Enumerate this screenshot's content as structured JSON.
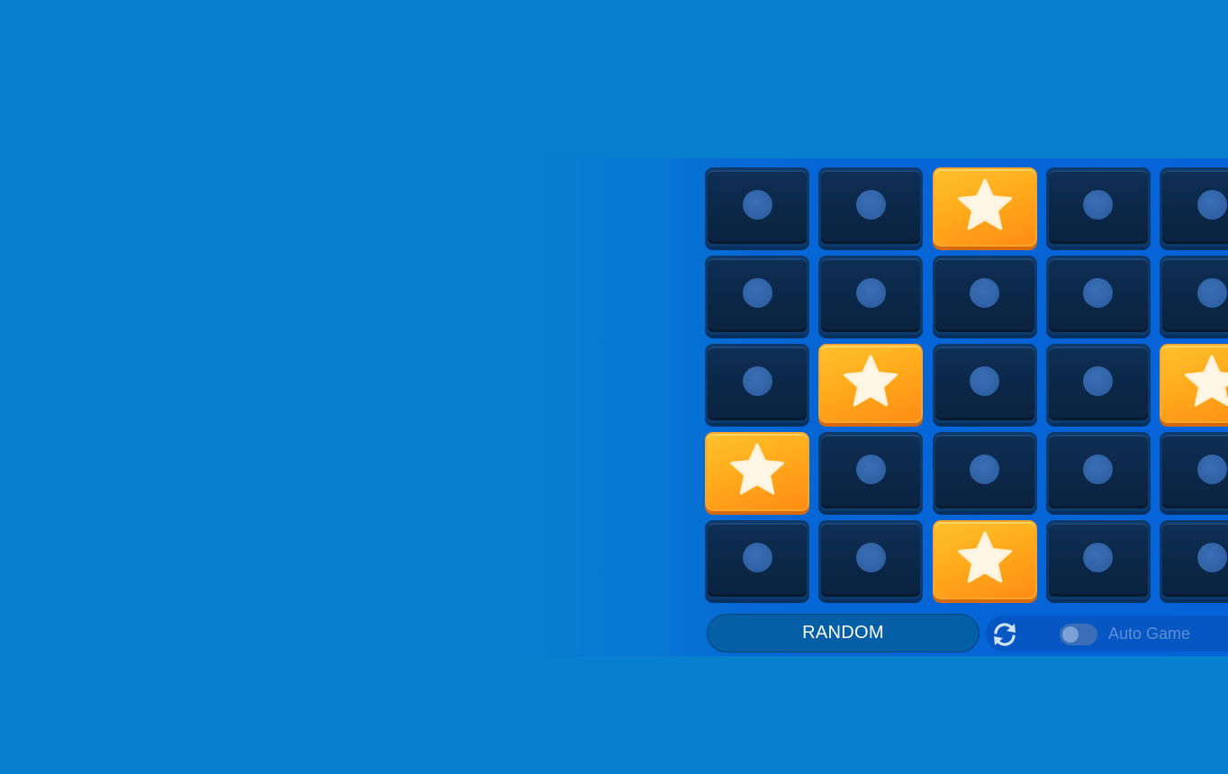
{
  "game": {
    "grid": {
      "rows": 5,
      "visible_columns": 5,
      "tiles": [
        [
          "closed",
          "closed",
          "star",
          "closed",
          "closed"
        ],
        [
          "closed",
          "closed",
          "closed",
          "closed",
          "closed"
        ],
        [
          "closed",
          "star",
          "closed",
          "closed",
          "star"
        ],
        [
          "star",
          "closed",
          "closed",
          "closed",
          "closed"
        ],
        [
          "closed",
          "closed",
          "star",
          "closed",
          "closed"
        ]
      ]
    },
    "icons": {
      "star": "star-icon",
      "closed": "hidden-tile-dot-icon",
      "refresh": "refresh-icon"
    }
  },
  "controls": {
    "random_label": "RANDOM",
    "auto_game_label": "Auto Game",
    "auto_game_enabled": false
  },
  "colors": {
    "background": "#0780cf",
    "star_tile": "#ffab1c",
    "closed_tile": "#0b2646",
    "random_button": "#045fa6"
  }
}
